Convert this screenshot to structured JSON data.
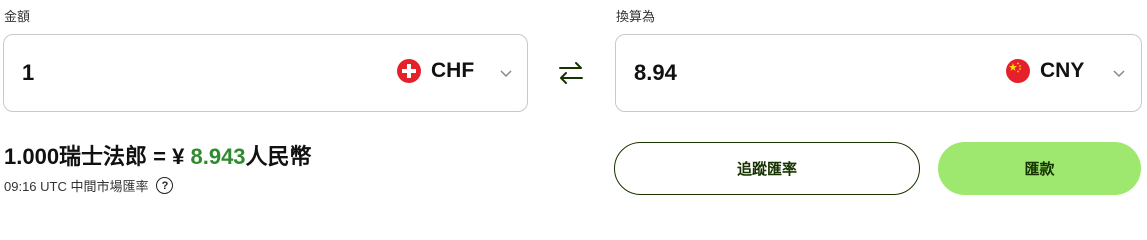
{
  "amount_label": "金額",
  "convert_label": "換算為",
  "from": {
    "value": "1",
    "currency": "CHF",
    "flag": "switzerland-flag"
  },
  "to": {
    "value": "8.94",
    "currency": "CNY",
    "flag": "china-flag"
  },
  "rate": {
    "prefix": "1.000瑞士法郎 = ¥ ",
    "value": "8.943",
    "suffix": "人民幣",
    "meta": "09:16 UTC 中間市場匯率",
    "help": "?"
  },
  "buttons": {
    "track": "追蹤匯率",
    "send": "匯款"
  },
  "colors": {
    "accent": "#9fe870",
    "dark_green": "#163300",
    "rate_green": "#2e8b2e"
  }
}
